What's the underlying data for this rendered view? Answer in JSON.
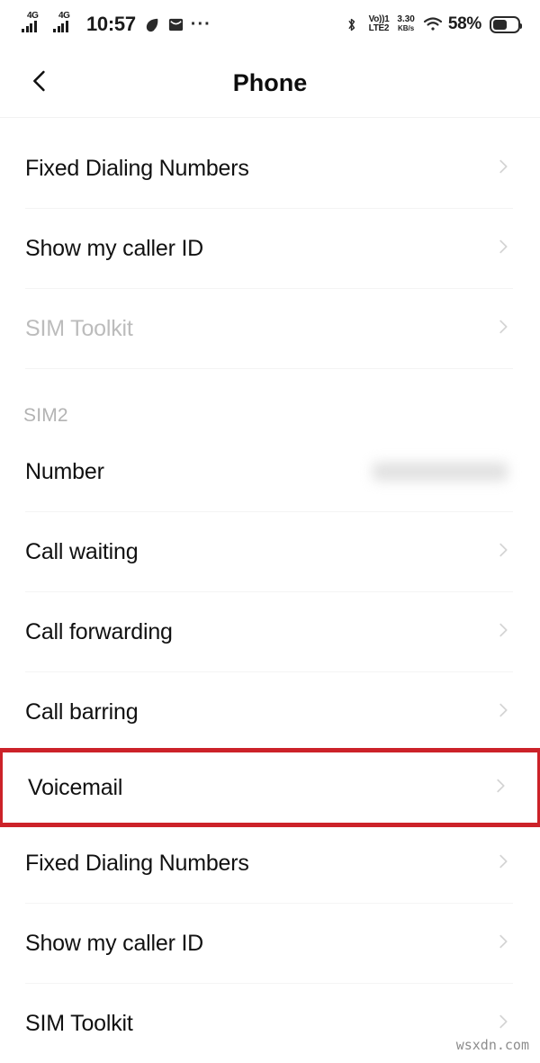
{
  "status_bar": {
    "signal_1": {
      "generation": "4G",
      "icon": "signal-bars-icon"
    },
    "signal_2": {
      "generation": "4G",
      "icon": "signal-bars-icon"
    },
    "time": "10:57",
    "icon_1": "alarm-leaf-icon",
    "icon_2": "envelope-icon",
    "overflow": "···",
    "bluetooth_icon": "bluetooth-icon",
    "volte_line1": "Vo))",
    "volte_line1_sim": "1",
    "volte_line2": "LTE2",
    "data_rate_value": "3.30",
    "data_rate_unit": "KB/s",
    "wifi_icon": "wifi-icon",
    "battery_percent": "58%",
    "battery_level": 58
  },
  "header": {
    "back_icon": "back-chevron-icon",
    "title": "Phone"
  },
  "list": [
    {
      "type": "row",
      "label": "Fixed Dialing Numbers",
      "disabled": false,
      "chevron": true,
      "highlighted": false
    },
    {
      "type": "divider"
    },
    {
      "type": "row",
      "label": "Show my caller ID",
      "disabled": false,
      "chevron": true,
      "highlighted": false
    },
    {
      "type": "divider"
    },
    {
      "type": "row",
      "label": "SIM Toolkit",
      "disabled": true,
      "chevron": true,
      "highlighted": false
    },
    {
      "type": "divider"
    },
    {
      "type": "section",
      "label": "SIM2"
    },
    {
      "type": "row",
      "label": "Number",
      "disabled": false,
      "chevron": false,
      "highlighted": false,
      "redacted_value": true
    },
    {
      "type": "divider"
    },
    {
      "type": "row",
      "label": "Call waiting",
      "disabled": false,
      "chevron": true,
      "highlighted": false
    },
    {
      "type": "divider"
    },
    {
      "type": "row",
      "label": "Call forwarding",
      "disabled": false,
      "chevron": true,
      "highlighted": false
    },
    {
      "type": "divider"
    },
    {
      "type": "row",
      "label": "Call barring",
      "disabled": false,
      "chevron": true,
      "highlighted": false
    },
    {
      "type": "divider"
    },
    {
      "type": "row",
      "label": "Voicemail",
      "disabled": false,
      "chevron": true,
      "highlighted": true
    },
    {
      "type": "divider"
    },
    {
      "type": "row",
      "label": "Fixed Dialing Numbers",
      "disabled": false,
      "chevron": true,
      "highlighted": false
    },
    {
      "type": "divider"
    },
    {
      "type": "row",
      "label": "Show my caller ID",
      "disabled": false,
      "chevron": true,
      "highlighted": false
    },
    {
      "type": "divider"
    },
    {
      "type": "row",
      "label": "SIM Toolkit",
      "disabled": false,
      "chevron": true,
      "highlighted": false
    }
  ],
  "watermark": "wsxdn.com",
  "colors": {
    "highlight": "#cc2229",
    "text": "#111111",
    "disabled_text": "#bcbcbc",
    "divider": "#f4f4f4",
    "chevron": "#d0d0d0"
  }
}
